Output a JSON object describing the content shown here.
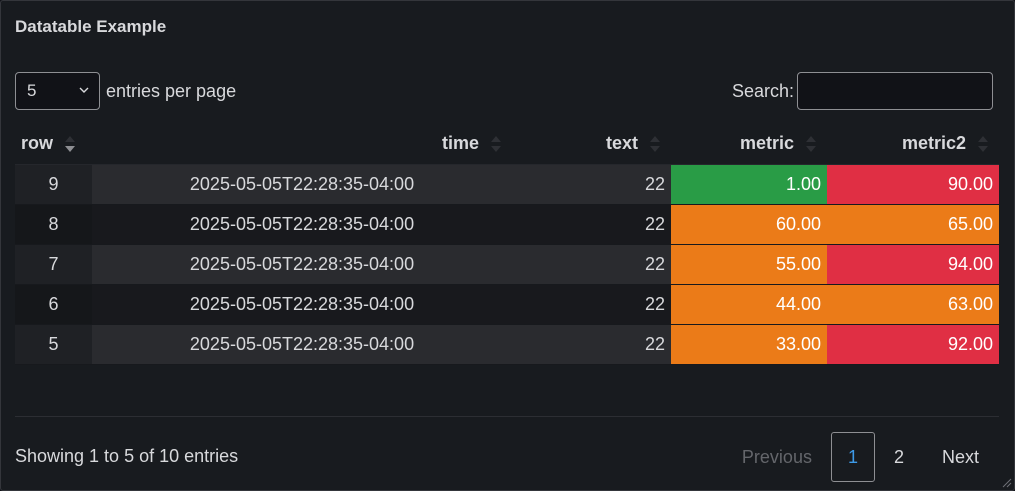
{
  "panel": {
    "title": "Datatable Example"
  },
  "controls": {
    "length_value": "5",
    "length_label": "entries per page",
    "search_label": "Search:",
    "search_value": "",
    "search_placeholder": ""
  },
  "table": {
    "headers": {
      "row": "row",
      "time": "time",
      "text": "text",
      "metric": "metric",
      "metric2": "metric2"
    },
    "sort": {
      "column": "row",
      "direction": "descending"
    },
    "rows": [
      {
        "row": "9",
        "time": "2025-05-05T22:28:35-04:00",
        "text": "22",
        "metric": "1.00",
        "metric2": "90.00"
      },
      {
        "row": "8",
        "time": "2025-05-05T22:28:35-04:00",
        "text": "22",
        "metric": "60.00",
        "metric2": "65.00"
      },
      {
        "row": "7",
        "time": "2025-05-05T22:28:35-04:00",
        "text": "22",
        "metric": "55.00",
        "metric2": "94.00"
      },
      {
        "row": "6",
        "time": "2025-05-05T22:28:35-04:00",
        "text": "22",
        "metric": "44.00",
        "metric2": "63.00"
      },
      {
        "row": "5",
        "time": "2025-05-05T22:28:35-04:00",
        "text": "22",
        "metric": "33.00",
        "metric2": "92.00"
      }
    ],
    "cell_colors": {
      "metric": [
        "#299c46",
        "#eb7b18",
        "#eb7b18",
        "#eb7b18",
        "#eb7b18"
      ],
      "metric2": [
        "#e02f44",
        "#eb7b18",
        "#e02f44",
        "#eb7b18",
        "#e02f44"
      ]
    }
  },
  "footer": {
    "info": "Showing 1 to 5 of 10 entries",
    "previous": "Previous",
    "pages": [
      "1",
      "2"
    ],
    "current_page": "1",
    "next": "Next"
  },
  "colors": {
    "green": "#299c46",
    "orange": "#eb7b18",
    "red": "#e02f44",
    "accent": "#3d9ae8"
  }
}
